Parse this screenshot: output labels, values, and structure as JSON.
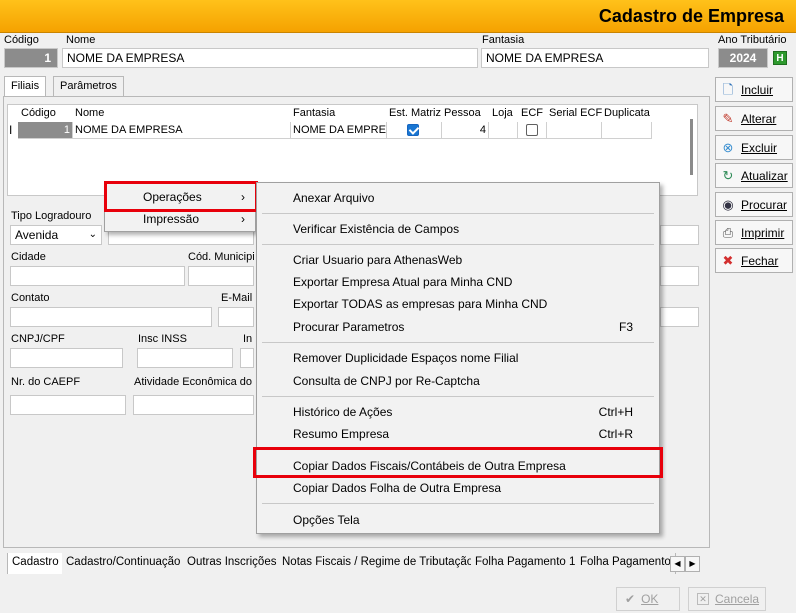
{
  "window": {
    "title": "Cadastro de Empresa"
  },
  "header": {
    "codigo_label": "Código",
    "codigo_value": "1",
    "nome_label": "Nome",
    "nome_value": "NOME DA EMPRESA",
    "fantasia_label": "Fantasia",
    "fantasia_value": "NOME DA EMPRESA",
    "ano_label": "Ano Tributário",
    "ano_value": "2024",
    "ano_btn": "H"
  },
  "tabs": [
    "Filiais",
    "Parâmetros"
  ],
  "grid": {
    "columns": [
      "Código",
      "Nome",
      "Fantasia",
      "Est. Matriz",
      "Pessoa",
      "Loja",
      "ECF",
      "Serial ECF",
      "Duplicata"
    ],
    "row": {
      "cursor": "I",
      "codigo": "1",
      "nome": "NOME DA EMPRESA",
      "fantasia": "NOME DA EMPRE",
      "matriz": true,
      "pessoa": "4",
      "ecf": false
    }
  },
  "form": {
    "tipo_logradouro_label": "Tipo Logradouro",
    "tipo_logradouro_value": "Avenida",
    "cidade_label": "Cidade",
    "cod_municipio_label": "Cód. Municipi",
    "contato_label": "Contato",
    "email_label": "E-Mail",
    "cnpj_label": "CNPJ/CPF",
    "inss_label": "Insc INSS",
    "ins_label": "In",
    "caepf_label": "Nr. do CAEPF",
    "atividade_label": "Atividade Econômica do"
  },
  "side_buttons": [
    {
      "label": "Incluir",
      "icon": "document-icon"
    },
    {
      "label": "Alterar",
      "icon": "edit-icon"
    },
    {
      "label": "Excluir",
      "icon": "delete-icon"
    },
    {
      "label": "Atualizar",
      "icon": "refresh-icon"
    },
    {
      "label": "Procurar",
      "icon": "binoculars-icon"
    },
    {
      "label": "Imprimir",
      "icon": "printer-icon"
    },
    {
      "label": "Fechar",
      "icon": "close-icon"
    }
  ],
  "context_menu": {
    "items": [
      {
        "label": "Operações"
      },
      {
        "label": "Impressão"
      }
    ]
  },
  "submenu": {
    "items": [
      {
        "label": "Anexar Arquivo",
        "shortcut": ""
      },
      {
        "label": "Verificar Existência de Campos",
        "shortcut": ""
      },
      {
        "label": "Criar Usuario para AthenasWeb",
        "shortcut": ""
      },
      {
        "label": "Exportar Empresa Atual para Minha CND",
        "shortcut": ""
      },
      {
        "label": "Exportar TODAS as empresas para Minha CND",
        "shortcut": ""
      },
      {
        "label": "Procurar Parametros",
        "shortcut": "F3"
      },
      {
        "label": "Remover Duplicidade Espaços nome Filial",
        "shortcut": ""
      },
      {
        "label": "Consulta de CNPJ por Re-Captcha",
        "shortcut": ""
      },
      {
        "label": "Histórico de Ações",
        "shortcut": "Ctrl+H"
      },
      {
        "label": "Resumo Empresa",
        "shortcut": "Ctrl+R"
      },
      {
        "label": "Copiar Dados Fiscais/Contábeis de Outra Empresa",
        "shortcut": ""
      },
      {
        "label": "Copiar Dados Folha de Outra Empresa",
        "shortcut": ""
      },
      {
        "label": "Opções Tela",
        "shortcut": ""
      }
    ]
  },
  "bottom_tabs": [
    "Cadastro",
    "Cadastro/Continuação",
    "Outras Inscrições",
    "Notas Fiscais / Regime de Tributação",
    "Folha Pagamento 1",
    "Folha Pagamento"
  ],
  "footer": {
    "ok": "OK",
    "cancel": "Cancela"
  },
  "colors": {
    "title_bar": "#f5a200",
    "highlight_box": "#e8000b",
    "checkbox_on": "#1976d2"
  }
}
